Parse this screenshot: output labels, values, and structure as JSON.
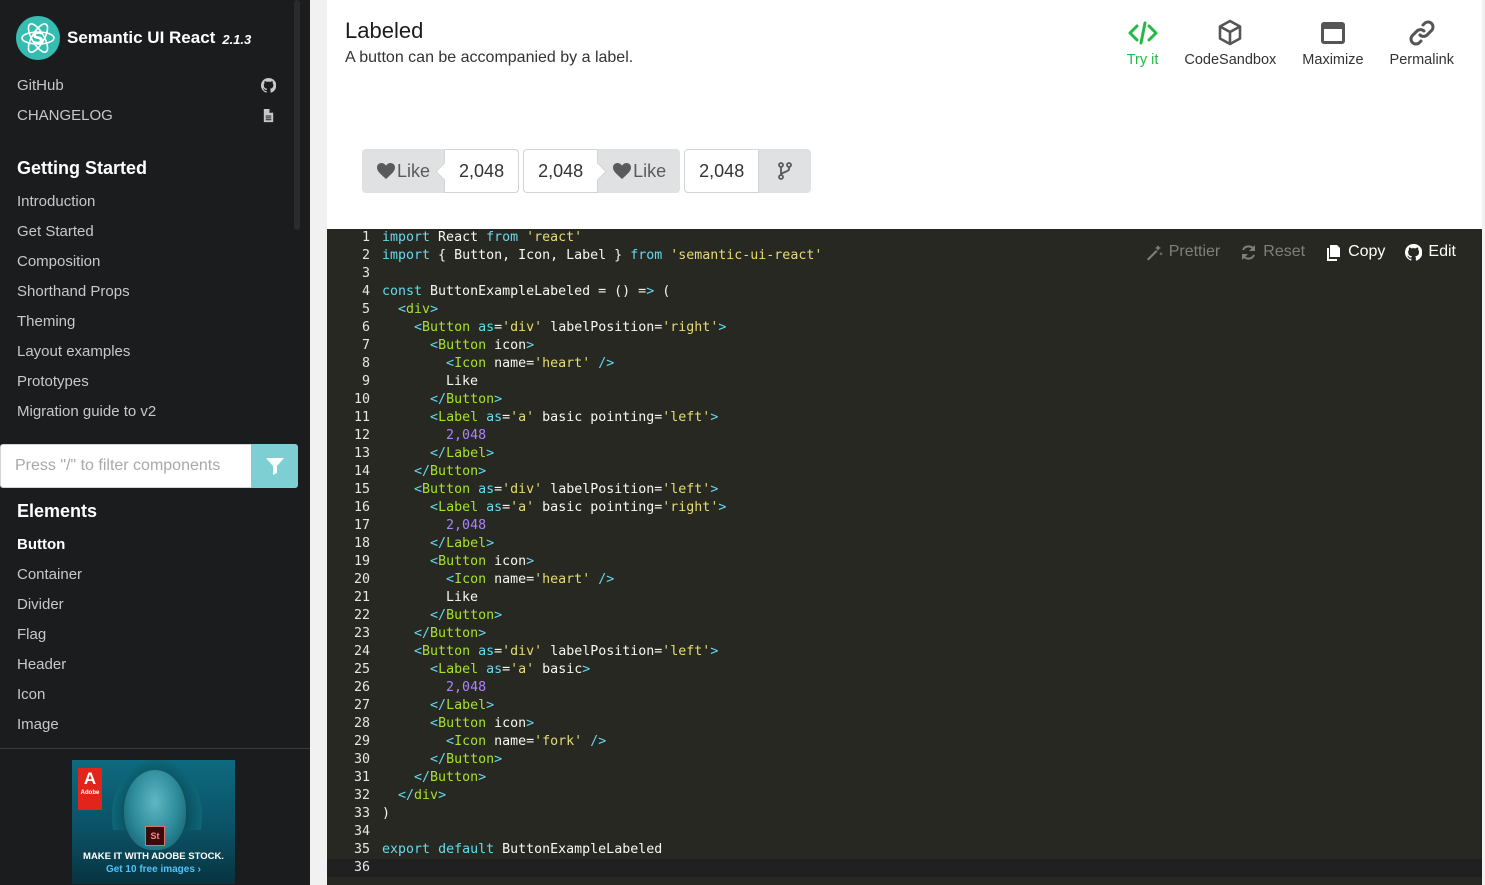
{
  "brand": {
    "title": "Semantic UI React",
    "version": "2.1.3"
  },
  "top_links": [
    {
      "label": "GitHub",
      "icon": "github-icon"
    },
    {
      "label": "CHANGELOG",
      "icon": "file-icon"
    }
  ],
  "getting_started": {
    "title": "Getting Started",
    "items": [
      "Introduction",
      "Get Started",
      "Composition",
      "Shorthand Props",
      "Theming",
      "Layout examples",
      "Prototypes",
      "Migration guide to v2"
    ]
  },
  "filter": {
    "placeholder": "Press \"/\" to filter components"
  },
  "elements": {
    "title": "Elements",
    "items": [
      "Button",
      "Container",
      "Divider",
      "Flag",
      "Header",
      "Icon",
      "Image"
    ],
    "active": "Button"
  },
  "ad": {
    "caption": "MAKE IT WITH ADOBE STOCK.",
    "cta": "Get 10 free images ›",
    "brand": "Adobe",
    "badge": "St"
  },
  "example": {
    "title": "Labeled",
    "description": "A button can be accompanied by a label."
  },
  "tools": [
    {
      "label": "Try it",
      "icon": "code-icon"
    },
    {
      "label": "CodeSandbox",
      "icon": "cube-icon"
    },
    {
      "label": "Maximize",
      "icon": "window-maximize-icon"
    },
    {
      "label": "Permalink",
      "icon": "link-icon"
    }
  ],
  "demo": {
    "like_label": "Like",
    "count": "2,048"
  },
  "editor_tools": [
    {
      "label": "Prettier",
      "icon": "magic-icon"
    },
    {
      "label": "Reset",
      "icon": "refresh-icon"
    },
    {
      "label": "Copy",
      "icon": "copy-icon"
    },
    {
      "label": "Edit",
      "icon": "github-icon"
    }
  ],
  "colors": {
    "accent": "#21ba45",
    "filter_button": "#7ecfd4",
    "sidebar_bg": "#1b1c1d",
    "editor_bg": "#272822"
  },
  "code_lines": [
    "import React from 'react'",
    "import { Button, Icon, Label } from 'semantic-ui-react'",
    "",
    "const ButtonExampleLabeled = () => (",
    "  <div>",
    "    <Button as='div' labelPosition='right'>",
    "      <Button icon>",
    "        <Icon name='heart' />",
    "        Like",
    "      </Button>",
    "      <Label as='a' basic pointing='left'>",
    "        2,048",
    "      </Label>",
    "    </Button>",
    "    <Button as='div' labelPosition='left'>",
    "      <Label as='a' basic pointing='right'>",
    "        2,048",
    "      </Label>",
    "      <Button icon>",
    "        <Icon name='heart' />",
    "        Like",
    "      </Button>",
    "    </Button>",
    "    <Button as='div' labelPosition='left'>",
    "      <Label as='a' basic>",
    "        2,048",
    "      </Label>",
    "      <Button icon>",
    "        <Icon name='fork' />",
    "      </Button>",
    "    </Button>",
    "  </div>",
    ")",
    "",
    "export default ButtonExampleLabeled",
    ""
  ]
}
